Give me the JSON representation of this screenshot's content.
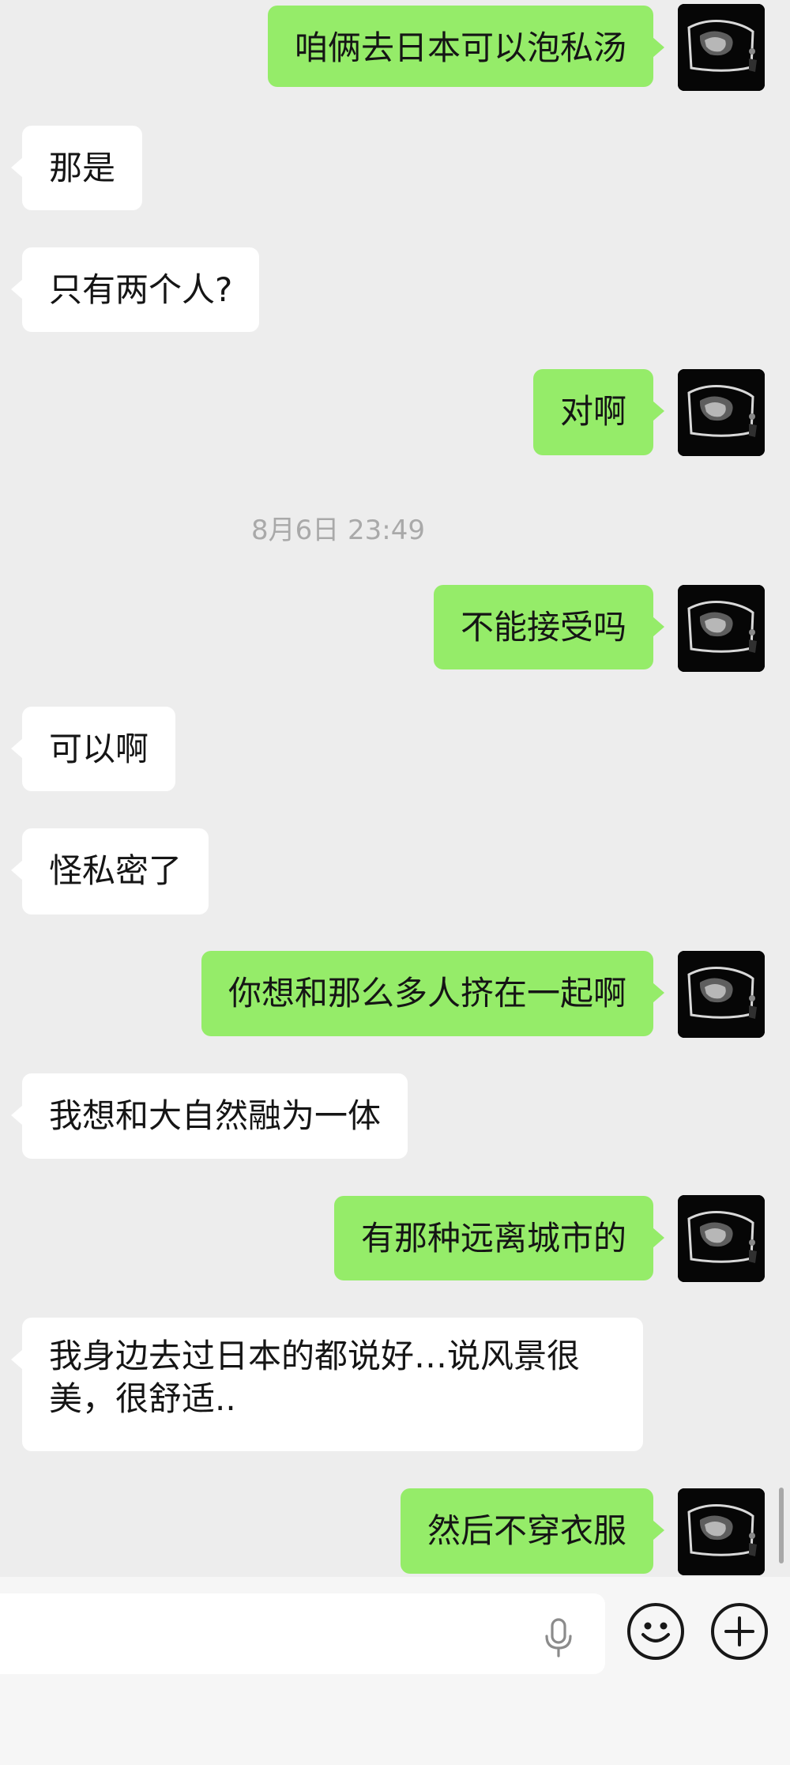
{
  "timestamp": "8月6日 23:49",
  "messages": [
    {
      "side": "out",
      "text": "咱俩去日本可以泡私汤"
    },
    {
      "side": "in",
      "text": "那是"
    },
    {
      "side": "in",
      "text": "只有两个人?"
    },
    {
      "side": "out",
      "text": "对啊"
    },
    {
      "side": "out",
      "text": "不能接受吗"
    },
    {
      "side": "in",
      "text": "可以啊"
    },
    {
      "side": "in",
      "text": "怪私密了"
    },
    {
      "side": "out",
      "text": "你想和那么多人挤在一起啊"
    },
    {
      "side": "in",
      "text": "我想和大自然融为一体"
    },
    {
      "side": "out",
      "text": "有那种远离城市的"
    },
    {
      "side": "in",
      "text": "我身边去过日本的都说好…说风景很美，很舒适.."
    },
    {
      "side": "out",
      "text": "然后不穿衣服"
    }
  ],
  "icons": {
    "avatar": "dark-photo-avatar",
    "voice": "microphone-icon",
    "emoji": "smiley-icon",
    "more": "plus-icon"
  },
  "colors": {
    "background": "#ededed",
    "outgoing_bubble": "#95ec69",
    "incoming_bubble": "#ffffff",
    "timestamp": "#a9a9a9"
  }
}
